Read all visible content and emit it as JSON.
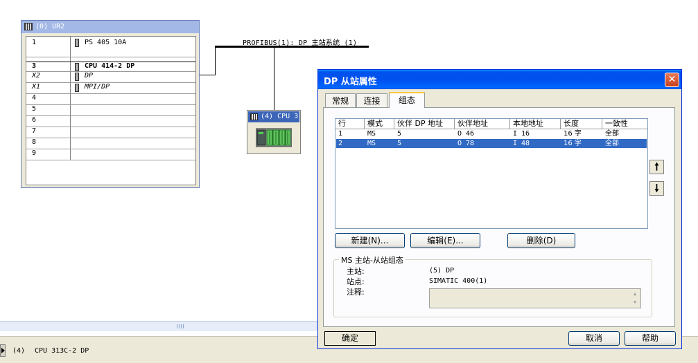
{
  "rack": {
    "title": "(0) UR2",
    "rows": [
      {
        "slot": "1",
        "module": "PS 405 10A",
        "style": "normal",
        "icon": "module-icon"
      },
      {
        "slot": "",
        "module": "",
        "style": "normal",
        "icon": ""
      },
      {
        "slot": "3",
        "module": "CPU 414-2 DP",
        "style": "bold",
        "icon": "cpu-module-icon"
      },
      {
        "slot": "X2",
        "module": "DP",
        "style": "italic",
        "icon": "interface-icon"
      },
      {
        "slot": "X1",
        "module": "MPI/DP",
        "style": "italic",
        "icon": "interface-icon"
      },
      {
        "slot": "4",
        "module": "",
        "style": "normal",
        "icon": ""
      },
      {
        "slot": "5",
        "module": "",
        "style": "normal",
        "icon": ""
      },
      {
        "slot": "6",
        "module": "",
        "style": "normal",
        "icon": ""
      },
      {
        "slot": "7",
        "module": "",
        "style": "normal",
        "icon": ""
      },
      {
        "slot": "8",
        "module": "",
        "style": "normal",
        "icon": ""
      },
      {
        "slot": "9",
        "module": "",
        "style": "normal",
        "icon": ""
      }
    ]
  },
  "network": {
    "bus_label": "PROFIBUS(1): DP 主站系统 (1)",
    "station_title": "(4) CPU 3",
    "station_icon": "s7-300-station-icon"
  },
  "status_bar": {
    "slot": "(4)",
    "name": "CPU 313C-2 DP"
  },
  "dialog": {
    "title": "DP 从站属性",
    "close_icon": "close-icon",
    "tabs": [
      "常规",
      "连接",
      "组态"
    ],
    "active_tab": "组态",
    "table": {
      "headers": [
        "行",
        "模式",
        "伙伴 DP 地址",
        "伙伴地址",
        "本地地址",
        "长度",
        "一致性"
      ],
      "rows": [
        {
          "row": "1",
          "mode": "MS",
          "partner_dp": "5",
          "partner_addr": "O 46",
          "local_addr": "I 16",
          "length": "16 字",
          "consistency": "全部",
          "selected": false
        },
        {
          "row": "2",
          "mode": "MS",
          "partner_dp": "5",
          "partner_addr": "O 78",
          "local_addr": "I 48",
          "length": "16 字",
          "consistency": "全部",
          "selected": true
        }
      ]
    },
    "move_up_icon": "arrow-up-icon",
    "move_down_icon": "arrow-down-icon",
    "buttons": {
      "new": "新建(N)...",
      "edit": "编辑(E)...",
      "delete": "删除(D)",
      "ok": "确定",
      "cancel": "取消",
      "help": "帮助"
    },
    "group": {
      "title": "MS 主站-从站组态",
      "master_label": "主站:",
      "master_value": "(5) DP",
      "station_label": "站点:",
      "station_value": "SIMATIC 400(1)",
      "comment_label": "注释:",
      "comment_value": ""
    }
  },
  "colors": {
    "selection": "#316ac5",
    "title_bar": "#0053ee",
    "dialog_bg": "#ece9d8"
  }
}
